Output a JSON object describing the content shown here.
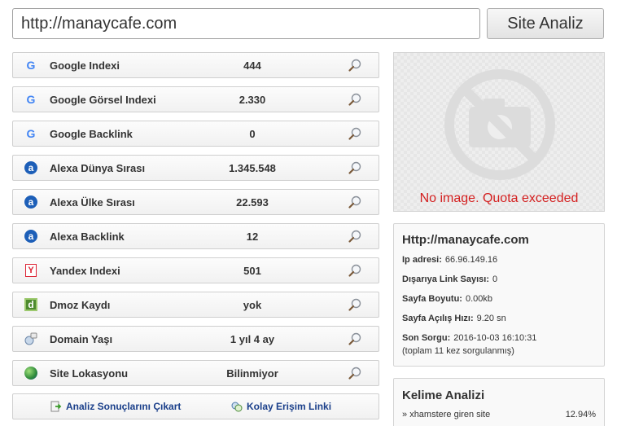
{
  "search": {
    "url_value": "http://manaycafe.com",
    "analyze_label": "Site Analiz"
  },
  "metrics": [
    {
      "icon": "google-icon",
      "label": "Google Indexi",
      "value": "444"
    },
    {
      "icon": "google-icon",
      "label": "Google Görsel Indexi",
      "value": "2.330"
    },
    {
      "icon": "google-icon",
      "label": "Google Backlink",
      "value": "0"
    },
    {
      "icon": "alexa-icon",
      "label": "Alexa Dünya Sırası",
      "value": "1.345.548"
    },
    {
      "icon": "alexa-icon",
      "label": "Alexa Ülke Sırası",
      "value": "22.593"
    },
    {
      "icon": "alexa-icon",
      "label": "Alexa Backlink",
      "value": "12"
    },
    {
      "icon": "yandex-icon",
      "label": "Yandex Indexi",
      "value": "501"
    },
    {
      "icon": "dmoz-icon",
      "label": "Dmoz Kaydı",
      "value": "yok"
    },
    {
      "icon": "domain-age-icon",
      "label": "Domain Yaşı",
      "value": "1 yıl 4 ay"
    },
    {
      "icon": "globe-icon",
      "label": "Site Lokasyonu",
      "value": "Bilinmiyor"
    }
  ],
  "actions": {
    "export_label": "Analiz Sonuçlarını Çıkart",
    "quick_link_label": "Kolay Erişim Linki"
  },
  "preview": {
    "message": "No image. Quota exceeded"
  },
  "site_info": {
    "title": "Http://manaycafe.com",
    "ip_label": "Ip adresi:",
    "ip_value": "66.96.149.16",
    "outlinks_label": "Dışarıya Link Sayısı:",
    "outlinks_value": "0",
    "size_label": "Sayfa Boyutu:",
    "size_value": "0.00kb",
    "speed_label": "Sayfa Açılış Hızı:",
    "speed_value": "9.20 sn",
    "last_query_label": "Son Sorgu:",
    "last_query_value": "2016-10-03 16:10:31",
    "query_count_note": "(toplam 11 kez sorgulanmış)"
  },
  "keywords": {
    "title": "Kelime Analizi",
    "items": [
      {
        "bullet": "»",
        "term": "xhamstere giren site",
        "percent": "12.94%"
      }
    ]
  },
  "colors": {
    "error_text": "#d42020",
    "link_text": "#1a3f8a",
    "google_blue": "#4285f4",
    "alexa_blue": "#1d5fb8",
    "yandex_red": "#dd2233",
    "dmoz_green": "#4d8a2e"
  }
}
